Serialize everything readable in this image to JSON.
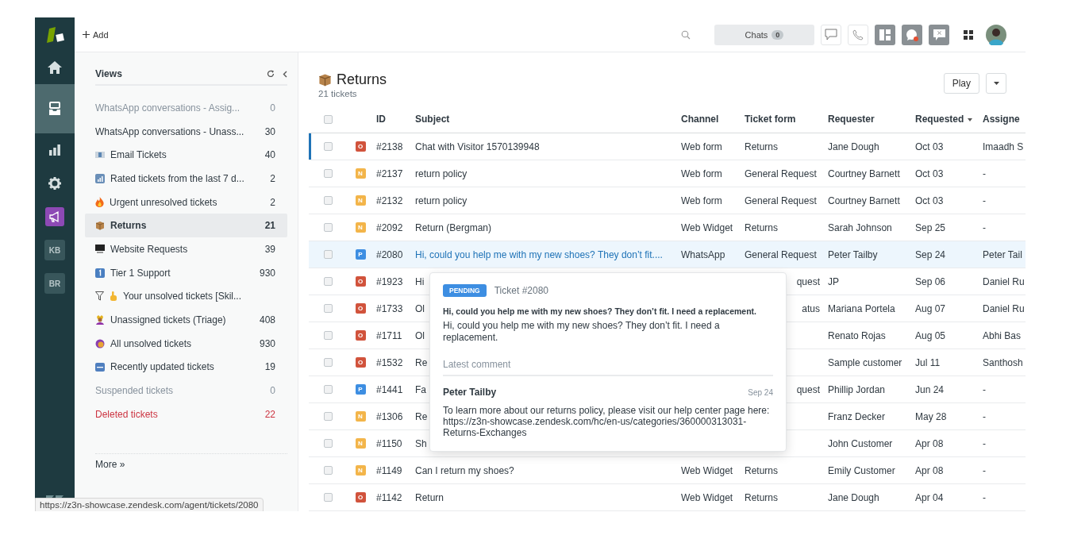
{
  "rail": {
    "items": [
      {
        "kind": "icon",
        "selected": false
      },
      {
        "kind": "icon",
        "selected": true
      },
      {
        "kind": "icon",
        "selected": false
      },
      {
        "kind": "icon",
        "selected": false
      },
      {
        "kind": "app",
        "selected": false
      },
      {
        "kind": "text",
        "label": "KB",
        "selected": false
      },
      {
        "kind": "text",
        "label": "BR",
        "selected": false
      }
    ]
  },
  "topbar": {
    "add_label": "Add",
    "chats": {
      "label": "Chats",
      "count": "0"
    }
  },
  "views": {
    "title": "Views",
    "items": [
      {
        "label": "WhatsApp conversations - Assig...",
        "count": "0",
        "kind": "muted",
        "selected": false
      },
      {
        "label": "WhatsApp conversations - Unass...",
        "count": "30",
        "kind": "normal",
        "selected": false
      },
      {
        "label": "Email Tickets",
        "count": "40",
        "kind": "normal",
        "selected": false
      },
      {
        "label": "Rated tickets from the last 7 d...",
        "count": "2",
        "kind": "normal",
        "selected": false
      },
      {
        "label": "Urgent unresolved tickets",
        "count": "2",
        "kind": "normal",
        "selected": false
      },
      {
        "label": "Returns",
        "count": "21",
        "kind": "normal",
        "selected": true
      },
      {
        "label": "Website Requests",
        "count": "39",
        "kind": "normal",
        "selected": false
      },
      {
        "label": "Tier 1 Support",
        "count": "930",
        "kind": "normal",
        "selected": false
      },
      {
        "label": "Your unsolved tickets [Skil...",
        "kind": "normal",
        "selected": false
      },
      {
        "label": "Unassigned tickets (Triage)",
        "count": "408",
        "kind": "normal",
        "selected": false
      },
      {
        "label": "All unsolved tickets",
        "count": "930",
        "kind": "normal",
        "selected": false
      },
      {
        "label": "Recently updated tickets",
        "count": "19",
        "kind": "normal",
        "selected": false
      },
      {
        "label": "Suspended tickets",
        "count": "0",
        "kind": "muted",
        "selected": false
      },
      {
        "label": "Deleted tickets",
        "count": "22",
        "kind": "danger",
        "selected": false
      }
    ],
    "more": "More »"
  },
  "header": {
    "title": "Returns",
    "subtitle": "21 tickets",
    "play": "Play"
  },
  "table": {
    "select_all": {
      "checked": false
    },
    "columns": [
      {
        "label": "ID",
        "sorted": false
      },
      {
        "label": "Subject",
        "sorted": false
      },
      {
        "label": "Channel",
        "sorted": false
      },
      {
        "label": "Ticket form",
        "sorted": false
      },
      {
        "label": "Requester",
        "sorted": false
      },
      {
        "label": "Requested",
        "sorted": true
      },
      {
        "label": "Assigne",
        "sorted": false
      }
    ],
    "rows": [
      {
        "status": "O",
        "color": "#d1533c",
        "id": "#2138",
        "subject": "Chat with Visitor 1570139948",
        "channel": "Web form",
        "form": "Returns",
        "requester": "Jane Dough",
        "requested": "Oct 03",
        "assignee": "Imaadh S",
        "checked": false,
        "focused": true,
        "hovered": false
      },
      {
        "status": "N",
        "color": "#f3b54a",
        "id": "#2137",
        "subject": "return policy",
        "channel": "Web form",
        "form": "General Request",
        "requester": "Courtney Barnett",
        "requested": "Oct 03",
        "assignee": "-",
        "checked": false,
        "focused": false,
        "hovered": false
      },
      {
        "status": "N",
        "color": "#f3b54a",
        "id": "#2132",
        "subject": "return policy",
        "channel": "Web form",
        "form": "General Request",
        "requester": "Courtney Barnett",
        "requested": "Oct 03",
        "assignee": "-",
        "checked": false,
        "focused": false,
        "hovered": false
      },
      {
        "status": "N",
        "color": "#f3b54a",
        "id": "#2092",
        "subject": "Return (Bergman)",
        "channel": "Web Widget",
        "form": "Returns",
        "requester": "Sarah Johnson",
        "requested": "Sep 25",
        "assignee": "-",
        "checked": false,
        "focused": false,
        "hovered": false
      },
      {
        "status": "P",
        "color": "#3d8ee2",
        "id": "#2080",
        "subject": "Hi, could you help me with my new shoes? They don’t fit....",
        "channel": "WhatsApp",
        "form": "General Request",
        "requester": "Peter Tailby",
        "requested": "Sep 24",
        "assignee": "Peter Tail",
        "checked": false,
        "focused": false,
        "hovered": true
      },
      {
        "status": "O",
        "color": "#d1533c",
        "id": "#1923",
        "subject": "Hi",
        "form_cut": "quest",
        "requester": "JP",
        "requested": "Sep 06",
        "assignee": "Daniel Ru",
        "checked": false,
        "focused": false,
        "hovered": false
      },
      {
        "status": "O",
        "color": "#d1533c",
        "id": "#1733",
        "subject": "Ol",
        "form_cut": "atus",
        "requester": "Mariana Portela",
        "requested": "Aug 07",
        "assignee": "Daniel Ru",
        "checked": false,
        "focused": false,
        "hovered": false
      },
      {
        "status": "O",
        "color": "#d1533c",
        "id": "#1711",
        "subject": "Ol",
        "requester": "Renato Rojas",
        "requested": "Aug 05",
        "assignee": "Abhi Bas",
        "checked": false,
        "focused": false,
        "hovered": false
      },
      {
        "status": "O",
        "color": "#d1533c",
        "id": "#1532",
        "subject": "Re",
        "requester": "Sample customer",
        "requested": "Jul 11",
        "assignee": "Santhosh",
        "checked": false,
        "focused": false,
        "hovered": false
      },
      {
        "status": "P",
        "color": "#3d8ee2",
        "id": "#1441",
        "subject": "Fa",
        "form_cut": "quest",
        "requester": "Phillip Jordan",
        "requested": "Jun 24",
        "assignee": "-",
        "checked": false,
        "focused": false,
        "hovered": false
      },
      {
        "status": "N",
        "color": "#f3b54a",
        "id": "#1306",
        "subject": "Re",
        "requester": "Franz Decker",
        "requested": "May 28",
        "assignee": "-",
        "checked": false,
        "focused": false,
        "hovered": false
      },
      {
        "status": "N",
        "color": "#f3b54a",
        "id": "#1150",
        "subject": "Sh",
        "requester": "John Customer",
        "requested": "Apr 08",
        "assignee": "-",
        "checked": false,
        "focused": false,
        "hovered": false
      },
      {
        "status": "N",
        "color": "#f3b54a",
        "id": "#1149",
        "subject": "Can I return my shoes?",
        "channel": "Web Widget",
        "form": "Returns",
        "requester": "Emily Customer",
        "requested": "Apr 08",
        "assignee": "-",
        "checked": false,
        "focused": false,
        "hovered": false
      },
      {
        "status": "O",
        "color": "#d1533c",
        "id": "#1142",
        "subject": "Return",
        "channel": "Web Widget",
        "form": "Returns",
        "requester": "Jane Dough",
        "requested": "Apr 04",
        "assignee": "-",
        "checked": false,
        "focused": false,
        "hovered": false
      }
    ]
  },
  "popover": {
    "status": "PENDING",
    "ticket": "Ticket #2080",
    "subject": "Hi, could you help me with my new shoes? They don’t fit. I need a replacement.",
    "description": "Hi, could you help me with my new shoes? They don’t fit. I need a replacement.",
    "section": "Latest comment",
    "author": "Peter Tailby",
    "date": "Sep 24",
    "comment": "To learn more about our returns policy, please visit our help center page here: https://z3n-showcase.zendesk.com/hc/en-us/categories/360000313031-Returns-Exchanges"
  },
  "status_url": "https://z3n-showcase.zendesk.com/agent/tickets/2080"
}
